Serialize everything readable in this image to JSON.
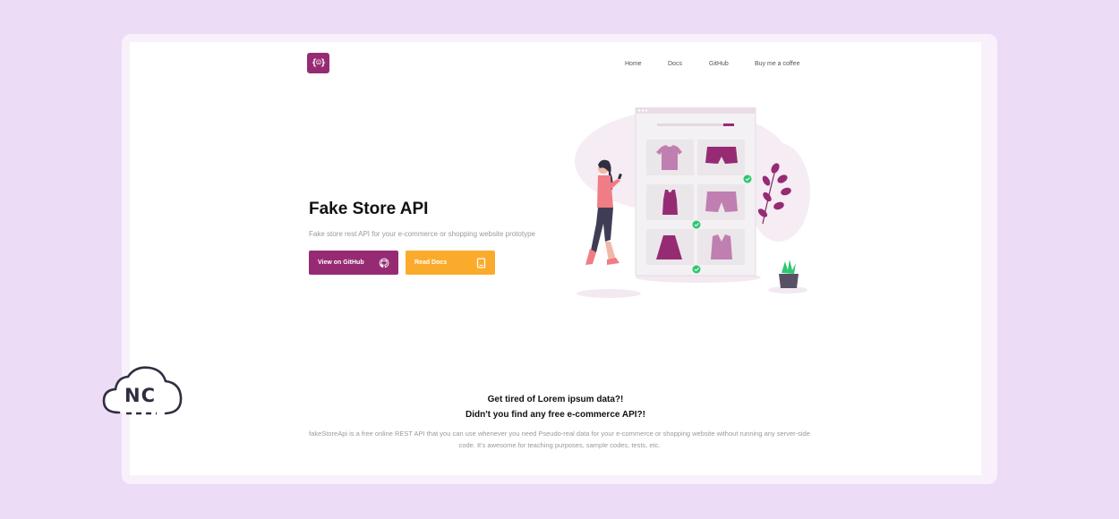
{
  "header": {
    "logo_glyph": "{☺}",
    "nav": [
      "Home",
      "Docs",
      "GitHub",
      "Buy me a coffee"
    ]
  },
  "hero": {
    "title": "Fake Store API",
    "subtitle": "Fake store rest API for your e-commerce or shopping website prototype",
    "primary_button": "View on GitHub",
    "secondary_button": "Read Docs"
  },
  "section": {
    "tagline_1": "Get tired of Lorem ipsum data?!",
    "tagline_2": "Didn't you find any free e-commerce API?!",
    "description": "fakeStoreApi is a free online REST API that you can use whenever you need Pseudo-real data for your e-commerce or shopping website without running any server-side code. It's awesome for teaching purposes, sample codes, tests, etc."
  },
  "badge": {
    "text": "NC"
  },
  "colors": {
    "primary": "#962b74",
    "secondary": "#fbab2c",
    "background": "#eddcf5"
  }
}
